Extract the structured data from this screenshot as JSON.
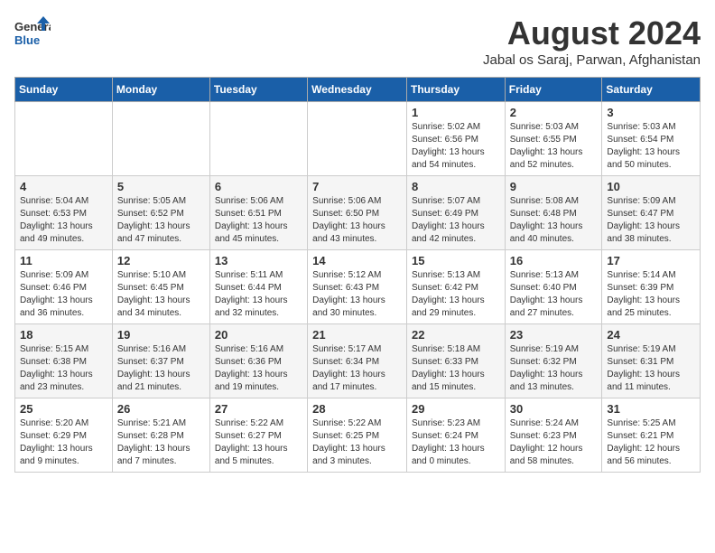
{
  "logo": {
    "general": "General",
    "blue": "Blue"
  },
  "title": "August 2024",
  "subtitle": "Jabal os Saraj, Parwan, Afghanistan",
  "days_of_week": [
    "Sunday",
    "Monday",
    "Tuesday",
    "Wednesday",
    "Thursday",
    "Friday",
    "Saturday"
  ],
  "weeks": [
    [
      {
        "day": "",
        "info": ""
      },
      {
        "day": "",
        "info": ""
      },
      {
        "day": "",
        "info": ""
      },
      {
        "day": "",
        "info": ""
      },
      {
        "day": "1",
        "info": "Sunrise: 5:02 AM\nSunset: 6:56 PM\nDaylight: 13 hours\nand 54 minutes."
      },
      {
        "day": "2",
        "info": "Sunrise: 5:03 AM\nSunset: 6:55 PM\nDaylight: 13 hours\nand 52 minutes."
      },
      {
        "day": "3",
        "info": "Sunrise: 5:03 AM\nSunset: 6:54 PM\nDaylight: 13 hours\nand 50 minutes."
      }
    ],
    [
      {
        "day": "4",
        "info": "Sunrise: 5:04 AM\nSunset: 6:53 PM\nDaylight: 13 hours\nand 49 minutes."
      },
      {
        "day": "5",
        "info": "Sunrise: 5:05 AM\nSunset: 6:52 PM\nDaylight: 13 hours\nand 47 minutes."
      },
      {
        "day": "6",
        "info": "Sunrise: 5:06 AM\nSunset: 6:51 PM\nDaylight: 13 hours\nand 45 minutes."
      },
      {
        "day": "7",
        "info": "Sunrise: 5:06 AM\nSunset: 6:50 PM\nDaylight: 13 hours\nand 43 minutes."
      },
      {
        "day": "8",
        "info": "Sunrise: 5:07 AM\nSunset: 6:49 PM\nDaylight: 13 hours\nand 42 minutes."
      },
      {
        "day": "9",
        "info": "Sunrise: 5:08 AM\nSunset: 6:48 PM\nDaylight: 13 hours\nand 40 minutes."
      },
      {
        "day": "10",
        "info": "Sunrise: 5:09 AM\nSunset: 6:47 PM\nDaylight: 13 hours\nand 38 minutes."
      }
    ],
    [
      {
        "day": "11",
        "info": "Sunrise: 5:09 AM\nSunset: 6:46 PM\nDaylight: 13 hours\nand 36 minutes."
      },
      {
        "day": "12",
        "info": "Sunrise: 5:10 AM\nSunset: 6:45 PM\nDaylight: 13 hours\nand 34 minutes."
      },
      {
        "day": "13",
        "info": "Sunrise: 5:11 AM\nSunset: 6:44 PM\nDaylight: 13 hours\nand 32 minutes."
      },
      {
        "day": "14",
        "info": "Sunrise: 5:12 AM\nSunset: 6:43 PM\nDaylight: 13 hours\nand 30 minutes."
      },
      {
        "day": "15",
        "info": "Sunrise: 5:13 AM\nSunset: 6:42 PM\nDaylight: 13 hours\nand 29 minutes."
      },
      {
        "day": "16",
        "info": "Sunrise: 5:13 AM\nSunset: 6:40 PM\nDaylight: 13 hours\nand 27 minutes."
      },
      {
        "day": "17",
        "info": "Sunrise: 5:14 AM\nSunset: 6:39 PM\nDaylight: 13 hours\nand 25 minutes."
      }
    ],
    [
      {
        "day": "18",
        "info": "Sunrise: 5:15 AM\nSunset: 6:38 PM\nDaylight: 13 hours\nand 23 minutes."
      },
      {
        "day": "19",
        "info": "Sunrise: 5:16 AM\nSunset: 6:37 PM\nDaylight: 13 hours\nand 21 minutes."
      },
      {
        "day": "20",
        "info": "Sunrise: 5:16 AM\nSunset: 6:36 PM\nDaylight: 13 hours\nand 19 minutes."
      },
      {
        "day": "21",
        "info": "Sunrise: 5:17 AM\nSunset: 6:34 PM\nDaylight: 13 hours\nand 17 minutes."
      },
      {
        "day": "22",
        "info": "Sunrise: 5:18 AM\nSunset: 6:33 PM\nDaylight: 13 hours\nand 15 minutes."
      },
      {
        "day": "23",
        "info": "Sunrise: 5:19 AM\nSunset: 6:32 PM\nDaylight: 13 hours\nand 13 minutes."
      },
      {
        "day": "24",
        "info": "Sunrise: 5:19 AM\nSunset: 6:31 PM\nDaylight: 13 hours\nand 11 minutes."
      }
    ],
    [
      {
        "day": "25",
        "info": "Sunrise: 5:20 AM\nSunset: 6:29 PM\nDaylight: 13 hours\nand 9 minutes."
      },
      {
        "day": "26",
        "info": "Sunrise: 5:21 AM\nSunset: 6:28 PM\nDaylight: 13 hours\nand 7 minutes."
      },
      {
        "day": "27",
        "info": "Sunrise: 5:22 AM\nSunset: 6:27 PM\nDaylight: 13 hours\nand 5 minutes."
      },
      {
        "day": "28",
        "info": "Sunrise: 5:22 AM\nSunset: 6:25 PM\nDaylight: 13 hours\nand 3 minutes."
      },
      {
        "day": "29",
        "info": "Sunrise: 5:23 AM\nSunset: 6:24 PM\nDaylight: 13 hours\nand 0 minutes."
      },
      {
        "day": "30",
        "info": "Sunrise: 5:24 AM\nSunset: 6:23 PM\nDaylight: 12 hours\nand 58 minutes."
      },
      {
        "day": "31",
        "info": "Sunrise: 5:25 AM\nSunset: 6:21 PM\nDaylight: 12 hours\nand 56 minutes."
      }
    ]
  ]
}
